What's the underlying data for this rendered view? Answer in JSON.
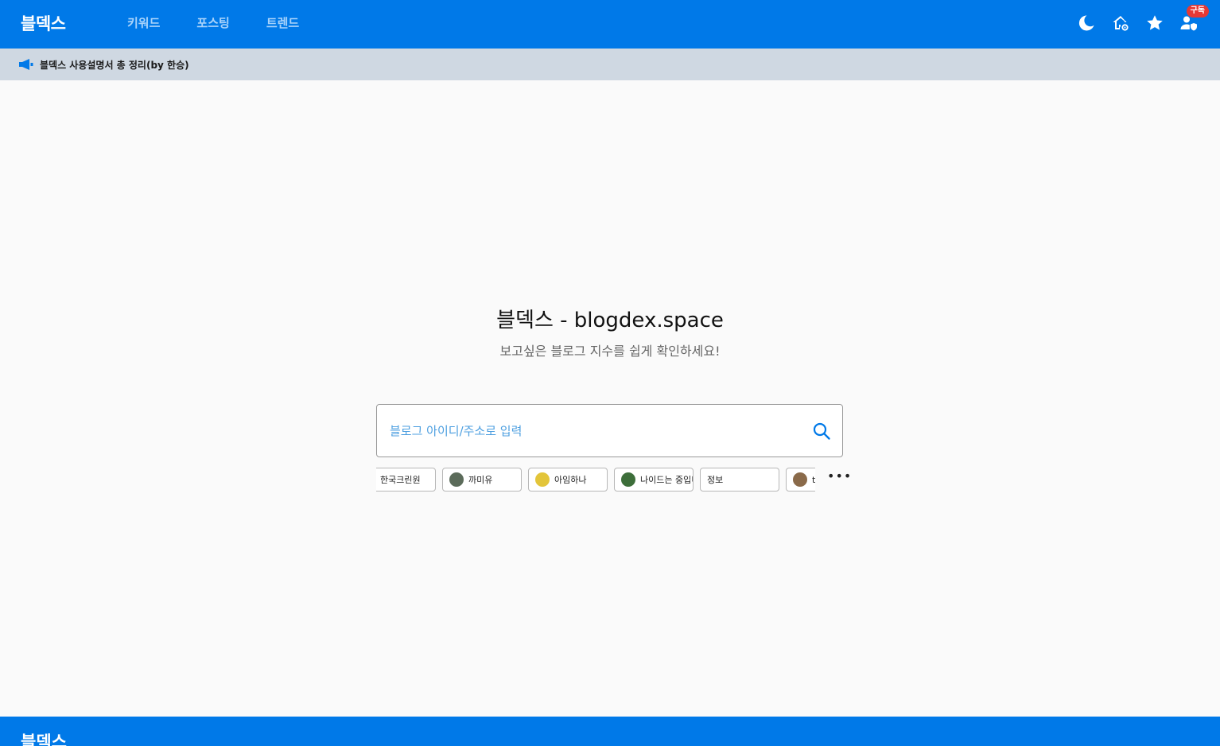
{
  "header": {
    "logo": "블덱스",
    "nav": [
      "키워드",
      "포스팅",
      "트렌드"
    ],
    "icons": [
      "moon-icon",
      "home-settings-icon",
      "star-icon",
      "user-shield-icon"
    ],
    "subscribe_badge": "구독",
    "colors": {
      "primary": "#0079e8",
      "nav_text": "#a8d3fb"
    }
  },
  "notice": {
    "icon": "megaphone-icon",
    "text": "블덱스 사용설명서 총 정리(by 한승)"
  },
  "hero": {
    "title": "블덱스 - blogdex.space",
    "subtitle": "보고싶은 블로그 지수를 쉽게 확인하세요!"
  },
  "search": {
    "placeholder": "블로그 아이디/주소로 입력",
    "value": ""
  },
  "recent": {
    "chips": [
      {
        "label": "한국크린원",
        "avatar": false
      },
      {
        "label": "까미유",
        "avatar": true,
        "color": "#5b6b5a"
      },
      {
        "label": "아임하나",
        "avatar": true,
        "color": "#e3c53a"
      },
      {
        "label": "나이드는 중입니다",
        "avatar": true,
        "color": "#3d6e3a"
      },
      {
        "label": "정보",
        "avatar": false
      },
      {
        "label": "tistory",
        "avatar": true,
        "color": "#8a6a4a"
      }
    ],
    "more": "•••"
  },
  "footer": {
    "logo": "블덱스"
  }
}
